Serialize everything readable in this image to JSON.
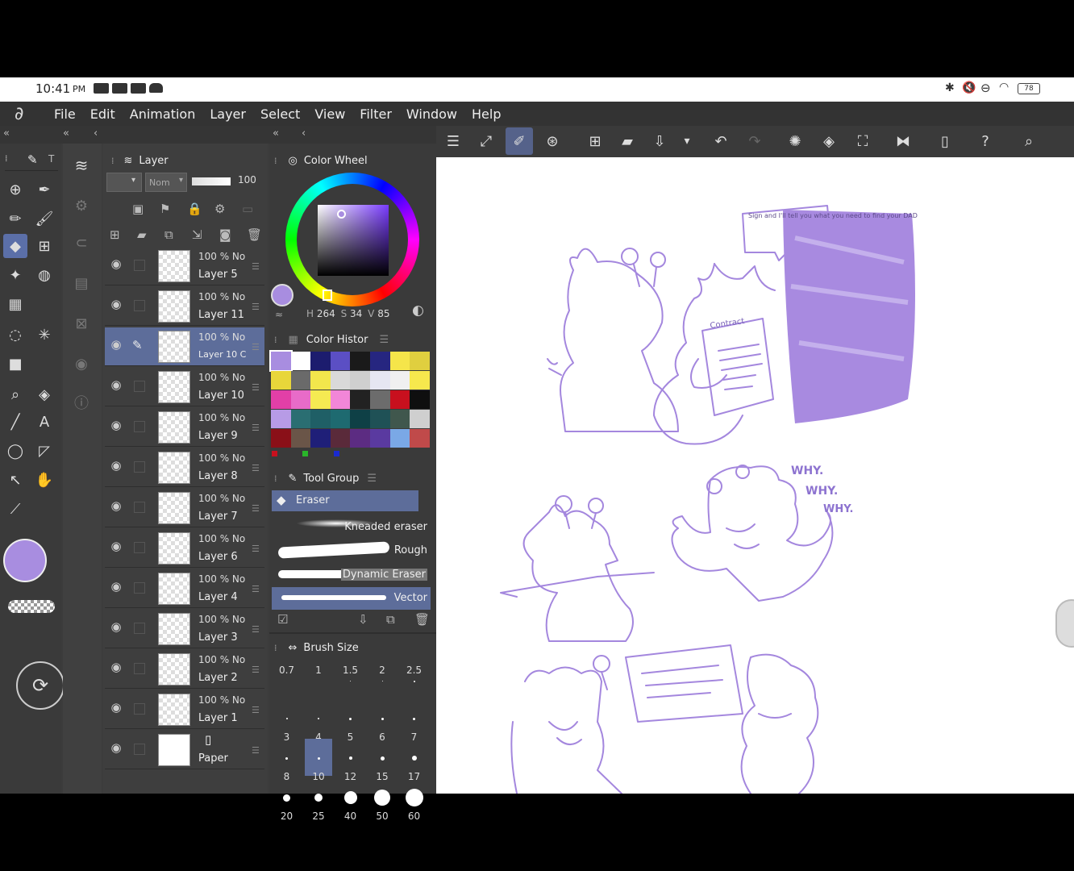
{
  "status": {
    "time": "10:41",
    "ampm": "PM",
    "battery": "78"
  },
  "menu": [
    "File",
    "Edit",
    "Animation",
    "Layer",
    "Select",
    "View",
    "Filter",
    "Window",
    "Help"
  ],
  "layer_panel": {
    "title": "Layer",
    "blend_mode": "Nom",
    "opacity": "100",
    "layers": [
      {
        "pct": "100 % No",
        "name": "Layer 5"
      },
      {
        "pct": "100 % No",
        "name": "Layer 11"
      },
      {
        "pct": "100 % No",
        "name": "Layer 10 C"
      },
      {
        "pct": "100 % No",
        "name": "Layer 10"
      },
      {
        "pct": "100 % No",
        "name": "Layer 9"
      },
      {
        "pct": "100 % No",
        "name": "Layer 8"
      },
      {
        "pct": "100 % No",
        "name": "Layer 7"
      },
      {
        "pct": "100 % No",
        "name": "Layer 6"
      },
      {
        "pct": "100 % No",
        "name": "Layer 4"
      },
      {
        "pct": "100 % No",
        "name": "Layer 3"
      },
      {
        "pct": "100 % No",
        "name": "Layer 2"
      },
      {
        "pct": "100 % No",
        "name": "Layer 1"
      }
    ],
    "paper": "Paper"
  },
  "color_wheel": {
    "title": "Color Wheel",
    "h": "264",
    "s": "34",
    "v": "85",
    "h_label": "H",
    "s_label": "S",
    "v_label": "V",
    "current_color": "#a88de0"
  },
  "color_history": {
    "title": "Color Histor",
    "colors": [
      "#a88de0",
      "#ffffff",
      "#1c1c6e",
      "#5b4fc4",
      "#1a1a1a",
      "#262680",
      "#f5e54a",
      "#e0cf3f",
      "#e8d63a",
      "#6a6a6a",
      "#f2e64c",
      "#d9d9d9",
      "#cfcfcf",
      "#e6e6f2",
      "#f0f0f0",
      "#f7e84d",
      "#e23fa7",
      "#e86bc8",
      "#f5ea52",
      "#f286d8",
      "#222222",
      "#6c6c6c",
      "#c8101e",
      "#0f0f0f",
      "#b79be6",
      "#2a6e72",
      "#1f5f66",
      "#1e6a70",
      "#0e4046",
      "#1f5156",
      "#40574d",
      "#cfcfcf",
      "#8a1018",
      "#6a5548",
      "#1f1f78",
      "#5a2a3a",
      "#5c2c82",
      "#5a3aa0",
      "#7aa8e6",
      "#c04a4a"
    ]
  },
  "tool_group": {
    "title": "Tool Group",
    "active_tool": "Eraser",
    "brushes": [
      "Kneaded eraser",
      "Rough",
      "Dynamic Eraser",
      "Vector"
    ]
  },
  "brush_size": {
    "title": "Brush Size",
    "sizes": [
      "0.7",
      "1",
      "1.5",
      "2",
      "2.5",
      "3",
      "4",
      "5",
      "6",
      "7",
      "8",
      "10",
      "12",
      "15",
      "17",
      "20",
      "25",
      "40",
      "50",
      "60"
    ],
    "selected": "10"
  },
  "canvas": {
    "speech_bubble": "Sign and I'll tell you what you need to find your DAD",
    "contract_text": "Contract",
    "shout_1": "WHY.",
    "shout_2": "WHY.",
    "shout_3": "WHY.",
    "ink_color": "#a487de",
    "fill_color": "#a88ae0"
  }
}
